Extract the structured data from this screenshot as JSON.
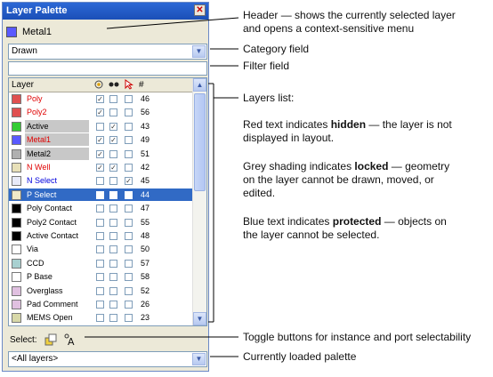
{
  "window": {
    "title": "Layer Palette",
    "close_glyph": "✕"
  },
  "header_layer": {
    "name": "Metal1",
    "color": "#5a5aff"
  },
  "category": {
    "value": "Drawn"
  },
  "filter": {
    "value": ""
  },
  "list": {
    "headers": {
      "layer": "Layer",
      "vis_icon": "eye-icon",
      "sel_icon": "selectability-icon",
      "lock_icon": "cursor-icon",
      "num": "#"
    },
    "rows": [
      {
        "name": "Poly",
        "num": "46",
        "text_color": "#e00000",
        "swatch": "#e05050",
        "shade": false,
        "selected": false,
        "c1": true,
        "c2": false,
        "c3": false
      },
      {
        "name": "Poly2",
        "num": "56",
        "text_color": "#e00000",
        "swatch": "#e05050",
        "shade": false,
        "selected": false,
        "c1": true,
        "c2": false,
        "c3": false
      },
      {
        "name": "Active",
        "num": "43",
        "text_color": "#000000",
        "swatch": "#33cc33",
        "shade": true,
        "selected": false,
        "c1": false,
        "c2": true,
        "c3": false
      },
      {
        "name": "Metal1",
        "num": "49",
        "text_color": "#e00000",
        "swatch": "#5a5aff",
        "shade": true,
        "selected": false,
        "c1": true,
        "c2": true,
        "c3": false
      },
      {
        "name": "Metal2",
        "num": "51",
        "text_color": "#000000",
        "swatch": "#b0b0b0",
        "shade": true,
        "selected": false,
        "c1": true,
        "c2": false,
        "c3": false
      },
      {
        "name": "N Well",
        "num": "42",
        "text_color": "#e00000",
        "swatch": "#e8e0b8",
        "shade": false,
        "selected": false,
        "c1": true,
        "c2": true,
        "c3": false
      },
      {
        "name": "N Select",
        "num": "45",
        "text_color": "#0000dd",
        "swatch": "#e8eaf8",
        "shade": false,
        "selected": false,
        "c1": false,
        "c2": false,
        "c3": true
      },
      {
        "name": "P Select",
        "num": "44",
        "text_color": "#ffffff",
        "swatch": "#f0e8c8",
        "shade": false,
        "selected": true,
        "c1": false,
        "c2": false,
        "c3": false
      },
      {
        "name": "Poly Contact",
        "num": "47",
        "text_color": "#000000",
        "swatch": "#000000",
        "shade": false,
        "selected": false,
        "c1": false,
        "c2": false,
        "c3": false
      },
      {
        "name": "Poly2 Contact",
        "num": "55",
        "text_color": "#000000",
        "swatch": "#000000",
        "shade": false,
        "selected": false,
        "c1": false,
        "c2": false,
        "c3": false
      },
      {
        "name": "Active Contact",
        "num": "48",
        "text_color": "#000000",
        "swatch": "#000000",
        "shade": false,
        "selected": false,
        "c1": false,
        "c2": false,
        "c3": false
      },
      {
        "name": "Via",
        "num": "50",
        "text_color": "#000000",
        "swatch": "#ffffff",
        "shade": false,
        "selected": false,
        "c1": false,
        "c2": false,
        "c3": false
      },
      {
        "name": "CCD",
        "num": "57",
        "text_color": "#000000",
        "swatch": "#a8d0d0",
        "shade": false,
        "selected": false,
        "c1": false,
        "c2": false,
        "c3": false
      },
      {
        "name": "P Base",
        "num": "58",
        "text_color": "#000000",
        "swatch": "#ffffff",
        "shade": false,
        "selected": false,
        "c1": false,
        "c2": false,
        "c3": false
      },
      {
        "name": "Overglass",
        "num": "52",
        "text_color": "#000000",
        "swatch": "#e0c0e0",
        "shade": false,
        "selected": false,
        "c1": false,
        "c2": false,
        "c3": false
      },
      {
        "name": "Pad Comment",
        "num": "26",
        "text_color": "#000000",
        "swatch": "#e0c0e0",
        "shade": false,
        "selected": false,
        "c1": false,
        "c2": false,
        "c3": false
      },
      {
        "name": "MEMS Open",
        "num": "23",
        "text_color": "#000000",
        "swatch": "#d8d8a8",
        "shade": false,
        "selected": false,
        "c1": false,
        "c2": false,
        "c3": false
      }
    ]
  },
  "select_row": {
    "label": "Select:"
  },
  "palette": {
    "value": "<All layers>"
  },
  "annotations": {
    "header": [
      "Header — shows the currently selected layer",
      "and opens a context-sensitive menu"
    ],
    "category": "Category field",
    "filter": "Filter field",
    "layers_list": "Layers list:",
    "red_pre": "Red text indicates ",
    "red_bold": "hidden",
    "red_post": " — the layer is not",
    "red_line2": "displayed in layout.",
    "grey_pre": "Grey shading indicates ",
    "grey_bold": "locked",
    "grey_post": " — geometry",
    "grey_line2": "on the layer cannot be drawn, moved, or",
    "grey_line3": "edited.",
    "blue_pre": "Blue text indicates ",
    "blue_bold": "protected",
    "blue_post": " — objects on",
    "blue_line2": "the layer cannot be selected.",
    "toggle": "Toggle buttons for instance and port selectability",
    "palette": "Currently loaded palette"
  }
}
